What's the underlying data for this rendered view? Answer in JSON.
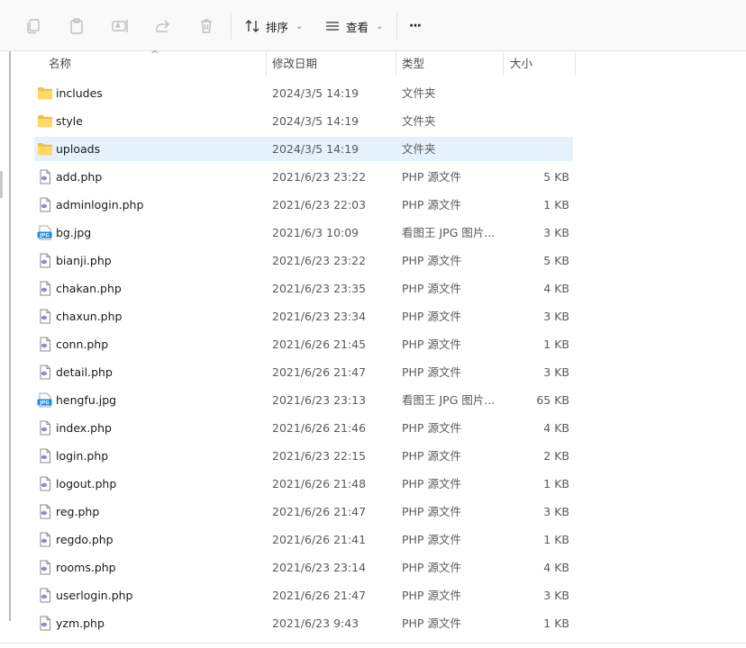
{
  "toolbar": {
    "sort_label": "排序",
    "view_label": "查看",
    "more_label": "···"
  },
  "columns": {
    "name": "名称",
    "date": "修改日期",
    "type": "类型",
    "size": "大小"
  },
  "files": [
    {
      "name": "includes",
      "date": "2024/3/5 14:19",
      "type": "文件夹",
      "size": "",
      "icon": "folder-icon"
    },
    {
      "name": "style",
      "date": "2024/3/5 14:19",
      "type": "文件夹",
      "size": "",
      "icon": "folder-icon"
    },
    {
      "name": "uploads",
      "date": "2024/3/5 14:19",
      "type": "文件夹",
      "size": "",
      "icon": "folder-icon",
      "selected": true
    },
    {
      "name": "add.php",
      "date": "2021/6/23 23:22",
      "type": "PHP 源文件",
      "size": "5 KB",
      "icon": "php-file-icon"
    },
    {
      "name": "adminlogin.php",
      "date": "2021/6/23 22:03",
      "type": "PHP 源文件",
      "size": "1 KB",
      "icon": "php-file-icon"
    },
    {
      "name": "bg.jpg",
      "date": "2021/6/3 10:09",
      "type": "看图王 JPG 图片...",
      "size": "3 KB",
      "icon": "jpg-file-icon"
    },
    {
      "name": "bianji.php",
      "date": "2021/6/23 23:22",
      "type": "PHP 源文件",
      "size": "5 KB",
      "icon": "php-file-icon"
    },
    {
      "name": "chakan.php",
      "date": "2021/6/23 23:35",
      "type": "PHP 源文件",
      "size": "4 KB",
      "icon": "php-file-icon"
    },
    {
      "name": "chaxun.php",
      "date": "2021/6/23 23:34",
      "type": "PHP 源文件",
      "size": "3 KB",
      "icon": "php-file-icon"
    },
    {
      "name": "conn.php",
      "date": "2021/6/26 21:45",
      "type": "PHP 源文件",
      "size": "1 KB",
      "icon": "php-file-icon"
    },
    {
      "name": "detail.php",
      "date": "2021/6/26 21:47",
      "type": "PHP 源文件",
      "size": "3 KB",
      "icon": "php-file-icon"
    },
    {
      "name": "hengfu.jpg",
      "date": "2021/6/23 23:13",
      "type": "看图王 JPG 图片...",
      "size": "65 KB",
      "icon": "jpg-file-icon"
    },
    {
      "name": "index.php",
      "date": "2021/6/26 21:46",
      "type": "PHP 源文件",
      "size": "4 KB",
      "icon": "php-file-icon"
    },
    {
      "name": "login.php",
      "date": "2021/6/23 22:15",
      "type": "PHP 源文件",
      "size": "2 KB",
      "icon": "php-file-icon"
    },
    {
      "name": "logout.php",
      "date": "2021/6/26 21:48",
      "type": "PHP 源文件",
      "size": "1 KB",
      "icon": "php-file-icon"
    },
    {
      "name": "reg.php",
      "date": "2021/6/26 21:47",
      "type": "PHP 源文件",
      "size": "3 KB",
      "icon": "php-file-icon"
    },
    {
      "name": "regdo.php",
      "date": "2021/6/26 21:41",
      "type": "PHP 源文件",
      "size": "1 KB",
      "icon": "php-file-icon"
    },
    {
      "name": "rooms.php",
      "date": "2021/6/23 23:14",
      "type": "PHP 源文件",
      "size": "4 KB",
      "icon": "php-file-icon"
    },
    {
      "name": "userlogin.php",
      "date": "2021/6/26 21:47",
      "type": "PHP 源文件",
      "size": "3 KB",
      "icon": "php-file-icon"
    },
    {
      "name": "yzm.php",
      "date": "2021/6/23 9:43",
      "type": "PHP 源文件",
      "size": "1 KB",
      "icon": "php-file-icon"
    }
  ]
}
